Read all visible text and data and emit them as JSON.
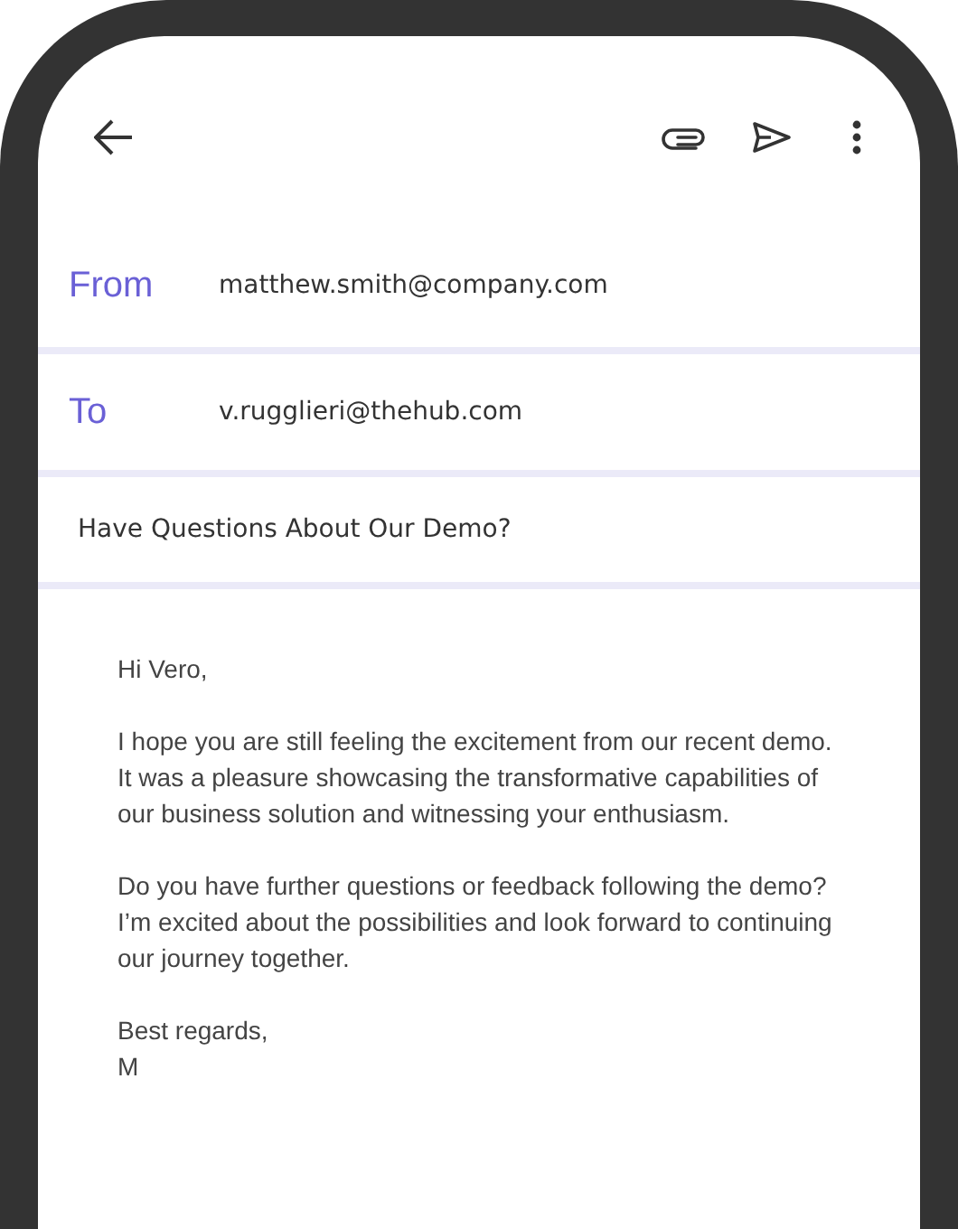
{
  "toolbar": {
    "icons": [
      {
        "kind": "back"
      },
      {
        "kind": "attach"
      },
      {
        "kind": "send"
      },
      {
        "kind": "more"
      }
    ]
  },
  "fields": [
    {
      "label": "From",
      "value": "matthew.smith@company.com"
    },
    {
      "label": "To",
      "value": "v.rugglieri@thehub.com"
    }
  ],
  "subject": "Have Questions About Our Demo?",
  "body": [
    "Hi Vero,",
    "I hope you are still feeling the excitement from our recent demo. It was a pleasure showcasing the transformative capabilities of our business solution and witnessing your enthusiasm.",
    "Do you have further questions or feedback following the demo?\nI’m excited about the possibilities and look forward to continuing our journey together.",
    "Best regards,\nM"
  ]
}
